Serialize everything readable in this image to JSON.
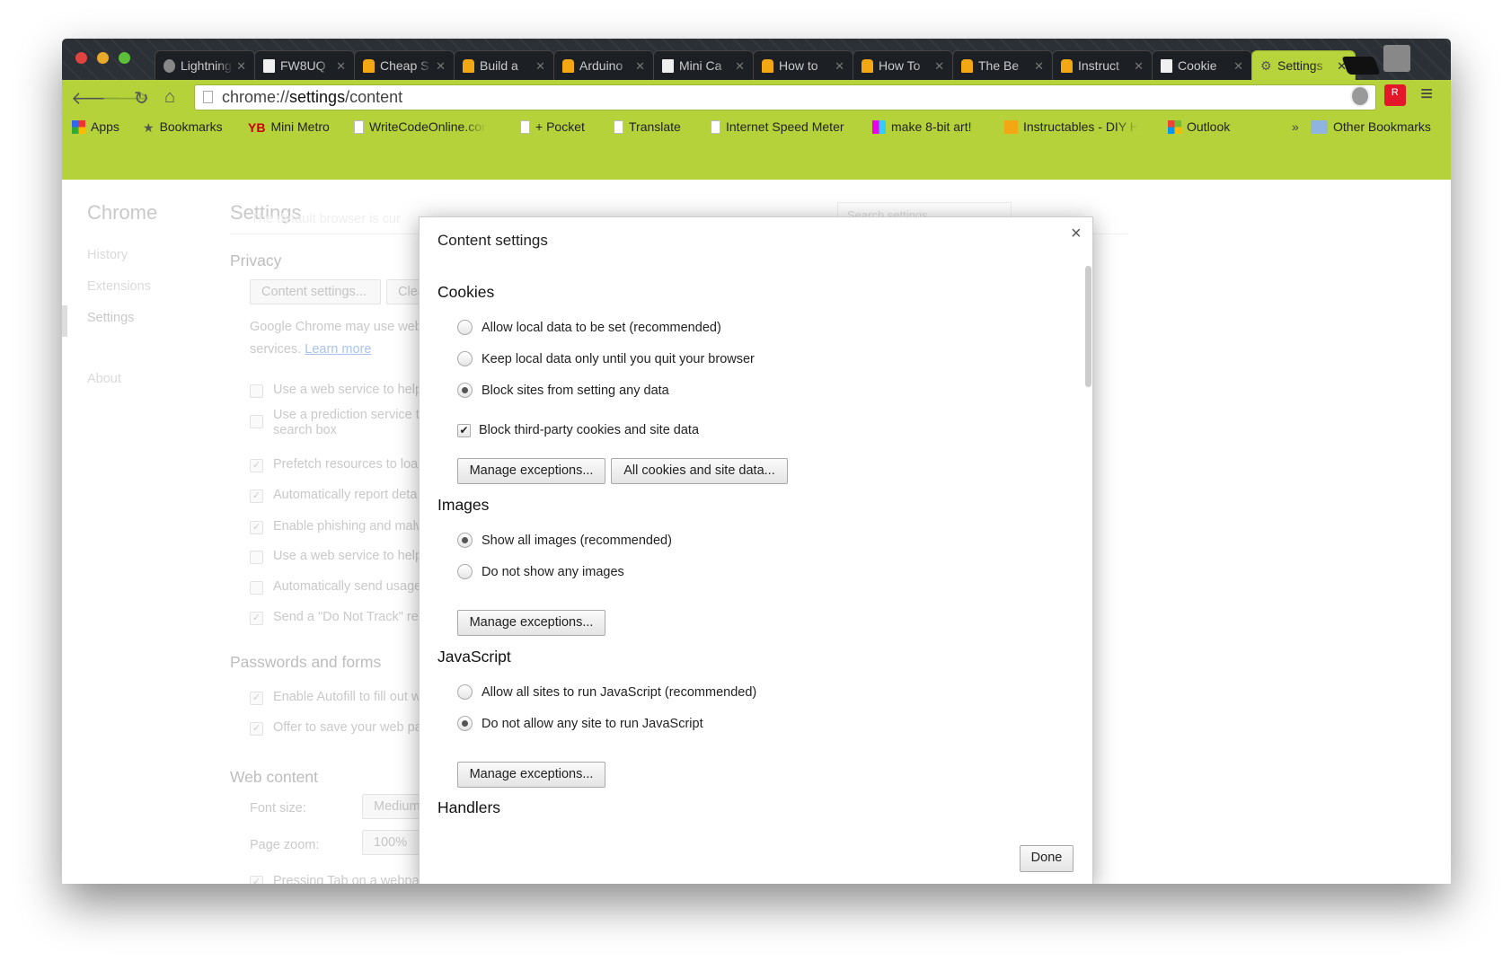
{
  "tabs": [
    {
      "label": "Lightning",
      "icon": "apple-icon"
    },
    {
      "label": "FW8UQ",
      "icon": "page-icon"
    },
    {
      "label": "Cheap S",
      "icon": "instructables-robot-icon"
    },
    {
      "label": "Build a",
      "icon": "instructables-robot-icon"
    },
    {
      "label": "Arduino",
      "icon": "instructables-robot-icon"
    },
    {
      "label": "Mini Ca",
      "icon": "page-icon"
    },
    {
      "label": "How to",
      "icon": "instructables-robot-icon"
    },
    {
      "label": "How To",
      "icon": "instructables-robot-icon"
    },
    {
      "label": "The Be",
      "icon": "instructables-robot-icon"
    },
    {
      "label": "Instruct",
      "icon": "instructables-robot-icon"
    },
    {
      "label": "Cookie",
      "icon": "page-icon"
    },
    {
      "label": "Settings",
      "icon": "gear-icon",
      "active": true
    }
  ],
  "address": {
    "prefix": "chrome://",
    "host": "settings",
    "path": "/content"
  },
  "bookmarks": [
    {
      "label": "Apps",
      "icon": "apps-grid-icon"
    },
    {
      "label": "Bookmarks",
      "icon": "star-icon"
    },
    {
      "label": "Mini Metro",
      "icon": "yb-icon"
    },
    {
      "label": "WriteCodeOnline.com",
      "icon": "page-icon"
    },
    {
      "label": "+ Pocket",
      "icon": "page-icon"
    },
    {
      "label": "Translate",
      "icon": "page-icon"
    },
    {
      "label": "Internet Speed Meter",
      "icon": "page-icon"
    },
    {
      "label": "make 8-bit art!",
      "icon": "color-squares-icon"
    },
    {
      "label": "Instructables - DIY How",
      "icon": "instructables-robot-icon"
    },
    {
      "label": "Outlook",
      "icon": "windows-logo-icon"
    }
  ],
  "bookmarks_overflow": "»",
  "other_bookmarks": "Other Bookmarks",
  "sidebar": {
    "title": "Chrome",
    "items": [
      "History",
      "Extensions",
      "Settings",
      "About"
    ]
  },
  "settings": {
    "title": "Settings",
    "search_placeholder": "Search settings",
    "default_browser_text": "The default browser is cur",
    "privacy": "Privacy",
    "content_settings_btn": "Content settings...",
    "clear_btn": "Clear browsing data...",
    "privacy_text1": "Google Chrome may use web",
    "privacy_text2": "services.",
    "learn_more": "Learn more",
    "privacy_options": [
      {
        "label": "Use a web service to help",
        "checked": false
      },
      {
        "label": "Use a prediction service t",
        "label2": "search box",
        "checked": false
      },
      {
        "label": "Prefetch resources to loa",
        "checked": true
      },
      {
        "label": "Automatically report deta",
        "checked": true
      },
      {
        "label": "Enable phishing and malw",
        "checked": true
      },
      {
        "label": "Use a web service to help",
        "checked": false
      },
      {
        "label": "Automatically send usage",
        "checked": false
      },
      {
        "label": "Send a \"Do Not Track\" re",
        "checked": true
      }
    ],
    "passwords": "Passwords and forms",
    "password_options": [
      {
        "label": "Enable Autofill to fill out w",
        "checked": true
      },
      {
        "label": "Offer to save your web pa",
        "checked": true
      }
    ],
    "web_content": "Web content",
    "font_size_label": "Font size:",
    "font_size_value": "Medium",
    "page_zoom_label": "Page zoom:",
    "page_zoom_value": "100%",
    "tab_option": "Pressing Tab on a webpage highlights links, as well as form fields"
  },
  "dialog": {
    "title": "Content settings",
    "close": "×",
    "cookies": {
      "heading": "Cookies",
      "options": [
        {
          "label": "Allow local data to be set (recommended)",
          "selected": false
        },
        {
          "label": "Keep local data only until you quit your browser",
          "selected": false
        },
        {
          "label": "Block sites from setting any data",
          "selected": true
        }
      ],
      "third_party": {
        "label": "Block third-party cookies and site data",
        "checked": true
      },
      "manage": "Manage exceptions...",
      "all_cookies": "All cookies and site data..."
    },
    "images": {
      "heading": "Images",
      "options": [
        {
          "label": "Show all images (recommended)",
          "selected": true
        },
        {
          "label": "Do not show any images",
          "selected": false
        }
      ],
      "manage": "Manage exceptions..."
    },
    "javascript": {
      "heading": "JavaScript",
      "options": [
        {
          "label": "Allow all sites to run JavaScript (recommended)",
          "selected": false
        },
        {
          "label": "Do not allow any site to run JavaScript",
          "selected": true
        }
      ],
      "manage": "Manage exceptions..."
    },
    "handlers": {
      "heading": "Handlers"
    },
    "done": "Done"
  },
  "colors": {
    "toolbar": "#b5d23b",
    "tabstrip": "#2b3036",
    "link": "#a9c4ee"
  }
}
